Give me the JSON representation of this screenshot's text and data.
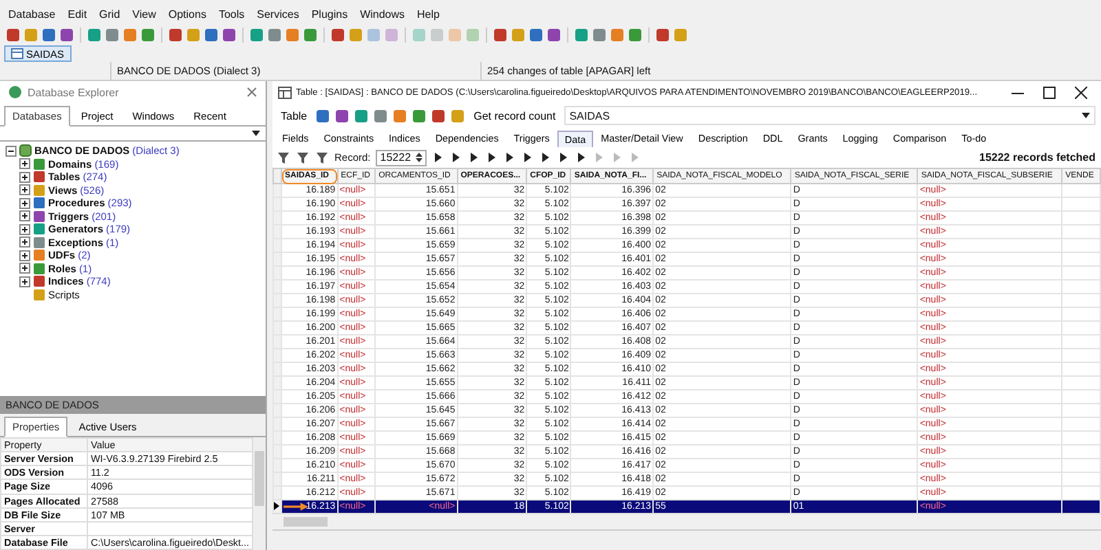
{
  "menu": [
    "Database",
    "Edit",
    "Grid",
    "View",
    "Options",
    "Tools",
    "Services",
    "Plugins",
    "Windows",
    "Help"
  ],
  "open_tabs": [
    {
      "label": "SAIDAS",
      "selected": true
    }
  ],
  "status_bar": {
    "database": "BANCO DE DADOS (Dialect 3)",
    "changes": "254 changes of table [APAGAR] left"
  },
  "explorer": {
    "title": "Database Explorer",
    "tabs": [
      {
        "label": "Databases",
        "selected": true
      },
      {
        "label": "Project",
        "selected": false
      },
      {
        "label": "Windows",
        "selected": false
      },
      {
        "label": "Recent",
        "selected": false
      }
    ],
    "tree": {
      "label": "BANCO DE DADOS",
      "note": "(Dialect 3)",
      "expanded": true,
      "children": [
        {
          "label": "Domains",
          "count": "(169)",
          "kind": "folder",
          "expanded": false
        },
        {
          "label": "Tables",
          "count": "(274)",
          "kind": "folder",
          "expanded": false
        },
        {
          "label": "Views",
          "count": "(526)",
          "kind": "folder",
          "expanded": false
        },
        {
          "label": "Procedures",
          "count": "(293)",
          "kind": "folder",
          "expanded": false
        },
        {
          "label": "Triggers",
          "count": "(201)",
          "kind": "folder",
          "expanded": false
        },
        {
          "label": "Generators",
          "count": "(179)",
          "kind": "folder",
          "expanded": false
        },
        {
          "label": "Exceptions",
          "count": "(1)",
          "kind": "folder",
          "expanded": false
        },
        {
          "label": "UDFs",
          "count": "(2)",
          "kind": "folder",
          "expanded": false
        },
        {
          "label": "Roles",
          "count": "(1)",
          "kind": "folder",
          "expanded": false
        },
        {
          "label": "Indices",
          "count": "(774)",
          "kind": "folder",
          "expanded": false
        },
        {
          "label": "Scripts",
          "kind": "leaf"
        }
      ]
    }
  },
  "properties": {
    "header": "BANCO DE DADOS",
    "tabs": [
      {
        "label": "Properties",
        "selected": true
      },
      {
        "label": "Active Users",
        "selected": false
      }
    ],
    "columns": [
      "Property",
      "Value"
    ],
    "rows": [
      [
        "Server Version",
        "WI-V6.3.9.27139 Firebird 2.5"
      ],
      [
        "ODS Version",
        "11.2"
      ],
      [
        "Page Size",
        "4096"
      ],
      [
        "Pages Allocated",
        "27588"
      ],
      [
        "DB File Size",
        "107 MB"
      ],
      [
        "Server",
        ""
      ],
      [
        "Database File",
        "C:\\Users\\carolina.figueiredo\\Deskt..."
      ]
    ]
  },
  "table_window": {
    "title": "Table : [SAIDAS] : BANCO DE DADOS (C:\\Users\\carolina.figueiredo\\Desktop\\ARQUIVOS PARA ATENDIMENTO\\NOVEMBRO 2019\\BANCO\\BANCO\\EAGLEERP2019...",
    "table_menu": "Table",
    "record_count_button": "Get record count",
    "table_name": "SAIDAS",
    "tabs": [
      {
        "label": "Fields",
        "selected": false
      },
      {
        "label": "Constraints",
        "selected": false
      },
      {
        "label": "Indices",
        "selected": false
      },
      {
        "label": "Dependencies",
        "selected": false
      },
      {
        "label": "Triggers",
        "selected": false
      },
      {
        "label": "Data",
        "selected": true
      },
      {
        "label": "Master/Detail View",
        "selected": false
      },
      {
        "label": "Description",
        "selected": false
      },
      {
        "label": "DDL",
        "selected": false
      },
      {
        "label": "Grants",
        "selected": false
      },
      {
        "label": "Logging",
        "selected": false
      },
      {
        "label": "Comparison",
        "selected": false
      },
      {
        "label": "To-do",
        "selected": false
      }
    ],
    "record_label": "Record:",
    "record_value": "15222",
    "fetched": "15222 records fetched",
    "columns": [
      {
        "label": "SAIDAS_ID",
        "bold": true,
        "kind": "number",
        "circled": true
      },
      {
        "label": "ECF_ID",
        "bold": false,
        "kind": "text",
        "circled": false
      },
      {
        "label": "ORCAMENTOS_ID",
        "bold": false,
        "kind": "number",
        "circled": false
      },
      {
        "label": "OPERACOES...",
        "bold": true,
        "kind": "number",
        "circled": false
      },
      {
        "label": "CFOP_ID",
        "bold": true,
        "kind": "number",
        "circled": false
      },
      {
        "label": "SAIDA_NOTA_FI...",
        "bold": true,
        "kind": "number",
        "circled": false
      },
      {
        "label": "SAIDA_NOTA_FISCAL_MODELO",
        "bold": false,
        "kind": "text",
        "circled": false
      },
      {
        "label": "SAIDA_NOTA_FISCAL_SERIE",
        "bold": false,
        "kind": "text",
        "circled": false
      },
      {
        "label": "SAIDA_NOTA_FISCAL_SUBSERIE",
        "bold": false,
        "kind": "text",
        "circled": false
      },
      {
        "label": "VENDE",
        "bold": false,
        "kind": "text",
        "circled": false
      }
    ],
    "rows": [
      {
        "cells": [
          "16.189",
          "<null>",
          "15.651",
          "32",
          "5.102",
          "16.396",
          "02",
          "D",
          "<null>"
        ],
        "null_flags": [
          false,
          true,
          false,
          false,
          false,
          false,
          false,
          false,
          true
        ],
        "selected": false,
        "arrow": false
      },
      {
        "cells": [
          "16.190",
          "<null>",
          "15.660",
          "32",
          "5.102",
          "16.397",
          "02",
          "D",
          "<null>"
        ],
        "null_flags": [
          false,
          true,
          false,
          false,
          false,
          false,
          false,
          false,
          true
        ],
        "selected": false,
        "arrow": false
      },
      {
        "cells": [
          "16.192",
          "<null>",
          "15.658",
          "32",
          "5.102",
          "16.398",
          "02",
          "D",
          "<null>"
        ],
        "null_flags": [
          false,
          true,
          false,
          false,
          false,
          false,
          false,
          false,
          true
        ],
        "selected": false,
        "arrow": false
      },
      {
        "cells": [
          "16.193",
          "<null>",
          "15.661",
          "32",
          "5.102",
          "16.399",
          "02",
          "D",
          "<null>"
        ],
        "null_flags": [
          false,
          true,
          false,
          false,
          false,
          false,
          false,
          false,
          true
        ],
        "selected": false,
        "arrow": false
      },
      {
        "cells": [
          "16.194",
          "<null>",
          "15.659",
          "32",
          "5.102",
          "16.400",
          "02",
          "D",
          "<null>"
        ],
        "null_flags": [
          false,
          true,
          false,
          false,
          false,
          false,
          false,
          false,
          true
        ],
        "selected": false,
        "arrow": false
      },
      {
        "cells": [
          "16.195",
          "<null>",
          "15.657",
          "32",
          "5.102",
          "16.401",
          "02",
          "D",
          "<null>"
        ],
        "null_flags": [
          false,
          true,
          false,
          false,
          false,
          false,
          false,
          false,
          true
        ],
        "selected": false,
        "arrow": false
      },
      {
        "cells": [
          "16.196",
          "<null>",
          "15.656",
          "32",
          "5.102",
          "16.402",
          "02",
          "D",
          "<null>"
        ],
        "null_flags": [
          false,
          true,
          false,
          false,
          false,
          false,
          false,
          false,
          true
        ],
        "selected": false,
        "arrow": false
      },
      {
        "cells": [
          "16.197",
          "<null>",
          "15.654",
          "32",
          "5.102",
          "16.403",
          "02",
          "D",
          "<null>"
        ],
        "null_flags": [
          false,
          true,
          false,
          false,
          false,
          false,
          false,
          false,
          true
        ],
        "selected": false,
        "arrow": false
      },
      {
        "cells": [
          "16.198",
          "<null>",
          "15.652",
          "32",
          "5.102",
          "16.404",
          "02",
          "D",
          "<null>"
        ],
        "null_flags": [
          false,
          true,
          false,
          false,
          false,
          false,
          false,
          false,
          true
        ],
        "selected": false,
        "arrow": false
      },
      {
        "cells": [
          "16.199",
          "<null>",
          "15.649",
          "32",
          "5.102",
          "16.406",
          "02",
          "D",
          "<null>"
        ],
        "null_flags": [
          false,
          true,
          false,
          false,
          false,
          false,
          false,
          false,
          true
        ],
        "selected": false,
        "arrow": false
      },
      {
        "cells": [
          "16.200",
          "<null>",
          "15.665",
          "32",
          "5.102",
          "16.407",
          "02",
          "D",
          "<null>"
        ],
        "null_flags": [
          false,
          true,
          false,
          false,
          false,
          false,
          false,
          false,
          true
        ],
        "selected": false,
        "arrow": false
      },
      {
        "cells": [
          "16.201",
          "<null>",
          "15.664",
          "32",
          "5.102",
          "16.408",
          "02",
          "D",
          "<null>"
        ],
        "null_flags": [
          false,
          true,
          false,
          false,
          false,
          false,
          false,
          false,
          true
        ],
        "selected": false,
        "arrow": false
      },
      {
        "cells": [
          "16.202",
          "<null>",
          "15.663",
          "32",
          "5.102",
          "16.409",
          "02",
          "D",
          "<null>"
        ],
        "null_flags": [
          false,
          true,
          false,
          false,
          false,
          false,
          false,
          false,
          true
        ],
        "selected": false,
        "arrow": false
      },
      {
        "cells": [
          "16.203",
          "<null>",
          "15.662",
          "32",
          "5.102",
          "16.410",
          "02",
          "D",
          "<null>"
        ],
        "null_flags": [
          false,
          true,
          false,
          false,
          false,
          false,
          false,
          false,
          true
        ],
        "selected": false,
        "arrow": false
      },
      {
        "cells": [
          "16.204",
          "<null>",
          "15.655",
          "32",
          "5.102",
          "16.411",
          "02",
          "D",
          "<null>"
        ],
        "null_flags": [
          false,
          true,
          false,
          false,
          false,
          false,
          false,
          false,
          true
        ],
        "selected": false,
        "arrow": false
      },
      {
        "cells": [
          "16.205",
          "<null>",
          "15.666",
          "32",
          "5.102",
          "16.412",
          "02",
          "D",
          "<null>"
        ],
        "null_flags": [
          false,
          true,
          false,
          false,
          false,
          false,
          false,
          false,
          true
        ],
        "selected": false,
        "arrow": false
      },
      {
        "cells": [
          "16.206",
          "<null>",
          "15.645",
          "32",
          "5.102",
          "16.413",
          "02",
          "D",
          "<null>"
        ],
        "null_flags": [
          false,
          true,
          false,
          false,
          false,
          false,
          false,
          false,
          true
        ],
        "selected": false,
        "arrow": false
      },
      {
        "cells": [
          "16.207",
          "<null>",
          "15.667",
          "32",
          "5.102",
          "16.414",
          "02",
          "D",
          "<null>"
        ],
        "null_flags": [
          false,
          true,
          false,
          false,
          false,
          false,
          false,
          false,
          true
        ],
        "selected": false,
        "arrow": false
      },
      {
        "cells": [
          "16.208",
          "<null>",
          "15.669",
          "32",
          "5.102",
          "16.415",
          "02",
          "D",
          "<null>"
        ],
        "null_flags": [
          false,
          true,
          false,
          false,
          false,
          false,
          false,
          false,
          true
        ],
        "selected": false,
        "arrow": false
      },
      {
        "cells": [
          "16.209",
          "<null>",
          "15.668",
          "32",
          "5.102",
          "16.416",
          "02",
          "D",
          "<null>"
        ],
        "null_flags": [
          false,
          true,
          false,
          false,
          false,
          false,
          false,
          false,
          true
        ],
        "selected": false,
        "arrow": false
      },
      {
        "cells": [
          "16.210",
          "<null>",
          "15.670",
          "32",
          "5.102",
          "16.417",
          "02",
          "D",
          "<null>"
        ],
        "null_flags": [
          false,
          true,
          false,
          false,
          false,
          false,
          false,
          false,
          true
        ],
        "selected": false,
        "arrow": false
      },
      {
        "cells": [
          "16.211",
          "<null>",
          "15.672",
          "32",
          "5.102",
          "16.418",
          "02",
          "D",
          "<null>"
        ],
        "null_flags": [
          false,
          true,
          false,
          false,
          false,
          false,
          false,
          false,
          true
        ],
        "selected": false,
        "arrow": false
      },
      {
        "cells": [
          "16.212",
          "<null>",
          "15.671",
          "32",
          "5.102",
          "16.419",
          "02",
          "D",
          "<null>"
        ],
        "null_flags": [
          false,
          true,
          false,
          false,
          false,
          false,
          false,
          false,
          true
        ],
        "selected": false,
        "arrow": false
      },
      {
        "cells": [
          "16.213",
          "<null>",
          "<null>",
          "18",
          "5.102",
          "16.213",
          "55",
          "01",
          "<null>"
        ],
        "null_flags": [
          false,
          true,
          true,
          false,
          false,
          false,
          false,
          false,
          true
        ],
        "selected": true,
        "arrow": true
      }
    ]
  }
}
